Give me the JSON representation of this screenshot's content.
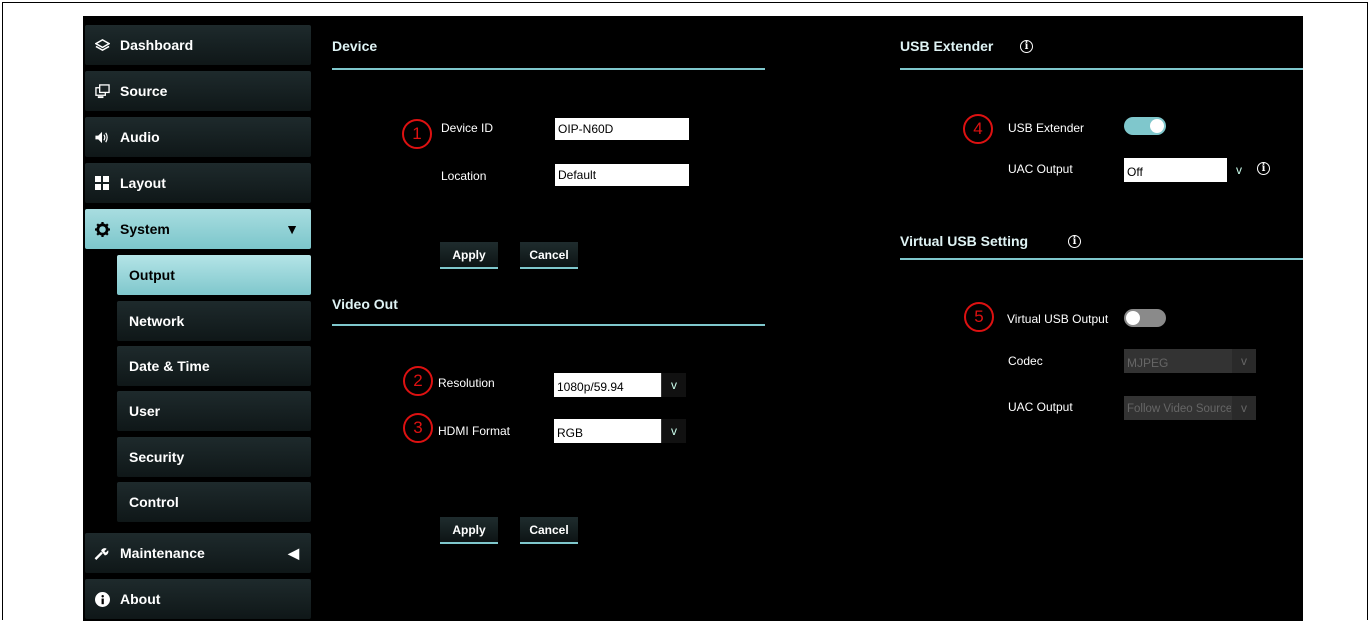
{
  "sidebar": {
    "items": [
      {
        "label": "Dashboard",
        "icon": "layers-icon"
      },
      {
        "label": "Source",
        "icon": "monitor-icon"
      },
      {
        "label": "Audio",
        "icon": "speaker-icon"
      },
      {
        "label": "Layout",
        "icon": "grid-icon"
      },
      {
        "label": "System",
        "icon": "gear-icon",
        "arrow": "▼"
      },
      {
        "label": "Maintenance",
        "icon": "wrench-icon",
        "arrow": "◀"
      },
      {
        "label": "About",
        "icon": "info-icon"
      }
    ],
    "subitems": [
      "Output",
      "Network",
      "Date & Time",
      "User",
      "Security",
      "Control"
    ],
    "active_color": "#7fc7cc"
  },
  "device": {
    "title": "Device",
    "device_id_label": "Device ID",
    "device_id_value": "OIP-N60D",
    "location_label": "Location",
    "location_value": "Default",
    "apply": "Apply",
    "cancel": "Cancel"
  },
  "video_out": {
    "title": "Video Out",
    "resolution_label": "Resolution",
    "resolution_value": "1080p/59.94",
    "hdmi_label": "HDMI Format",
    "hdmi_value": "RGB",
    "apply": "Apply",
    "cancel": "Cancel"
  },
  "usb_extender": {
    "title": "USB Extender",
    "extender_label": "USB Extender",
    "extender_on": true,
    "uac_label": "UAC Output",
    "uac_value": "Off"
  },
  "virtual_usb": {
    "title": "Virtual USB Setting",
    "output_label": "Virtual USB Output",
    "output_on": false,
    "codec_label": "Codec",
    "codec_value": "MJPEG",
    "uac_label": "UAC Output",
    "uac_value": "Follow Video Source"
  },
  "callouts": [
    "1",
    "2",
    "3",
    "4",
    "5"
  ],
  "select_arrow": "v",
  "info_glyph": "i"
}
